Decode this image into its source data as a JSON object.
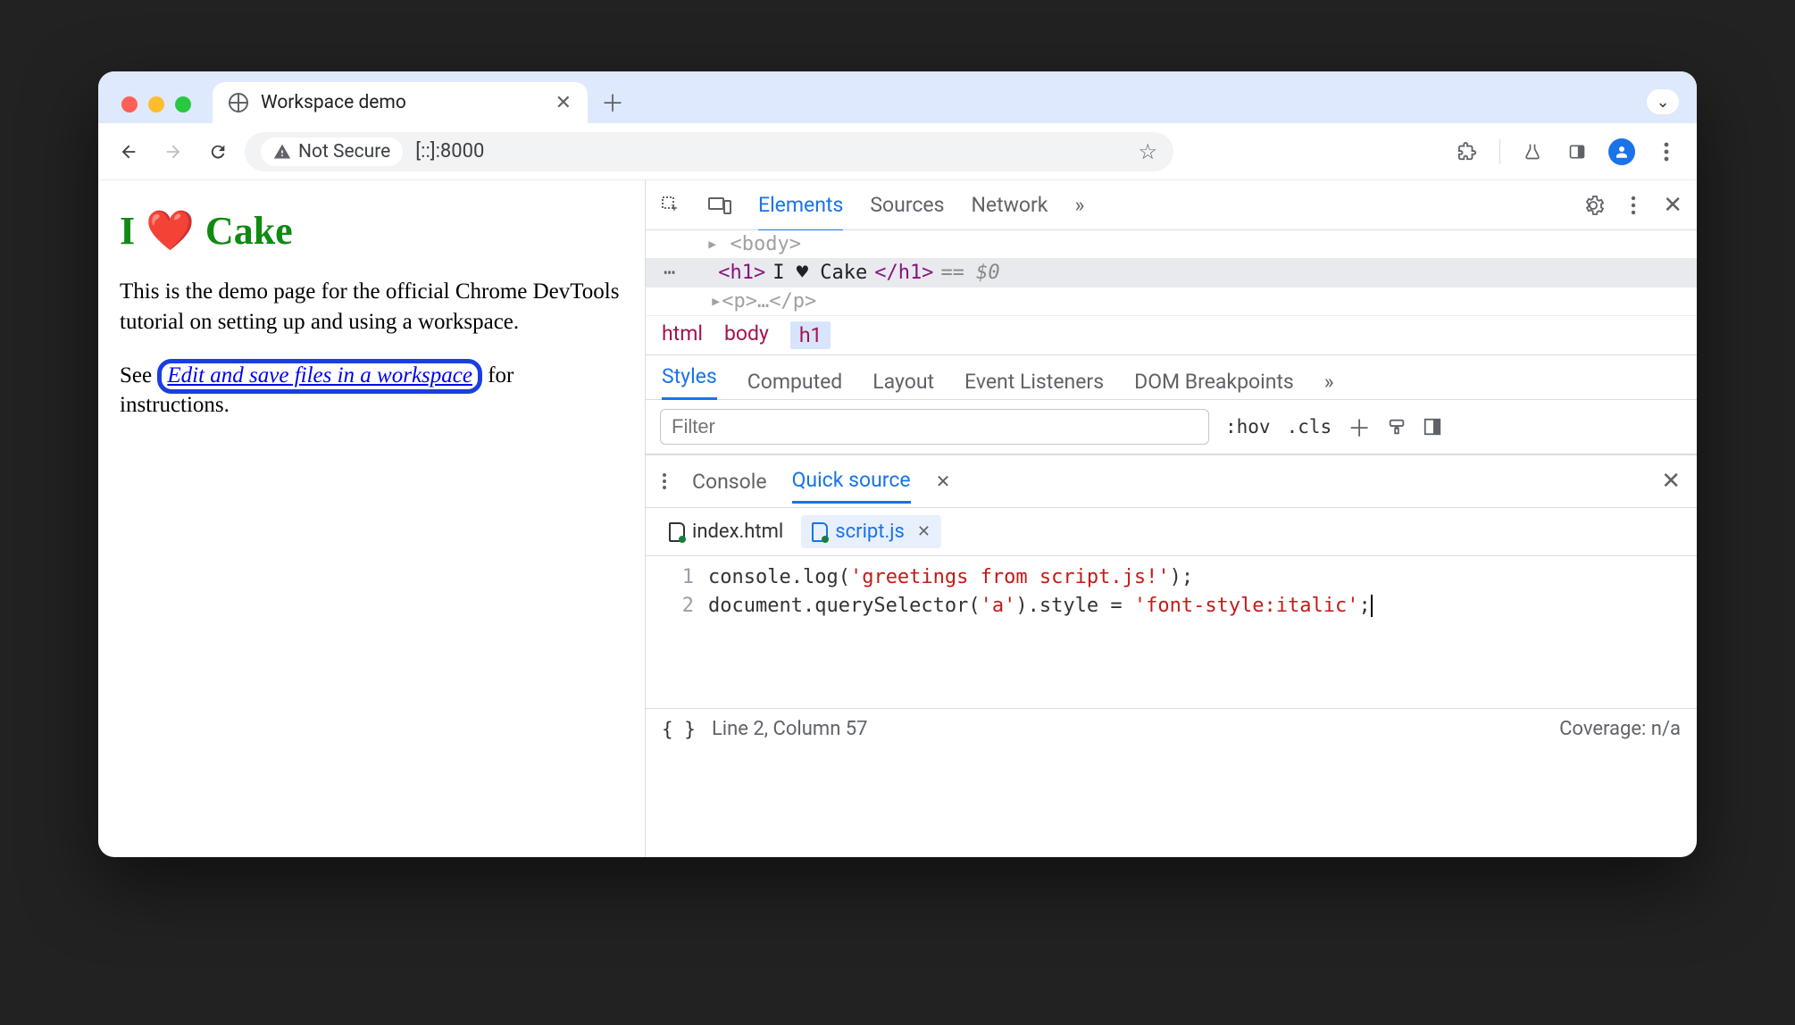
{
  "browser": {
    "tab_title": "Workspace demo",
    "security_chip": "Not Secure",
    "url": "[::]:8000"
  },
  "page": {
    "heading_prefix": "I",
    "heading_emoji": "❤️",
    "heading_suffix": "Cake",
    "paragraph": "This is the demo page for the official Chrome DevTools tutorial on setting up and using a workspace.",
    "cta_prefix": "See ",
    "cta_link": "Edit and save files in a workspace",
    "cta_suffix": " for instructions."
  },
  "devtools": {
    "tabs": {
      "elements": "Elements",
      "sources": "Sources",
      "network": "Network",
      "more": "»"
    },
    "dom": {
      "prev_line": "▸ <body>",
      "selected_open": "<h1>",
      "selected_text": "I ♥ Cake",
      "selected_close": "</h1>",
      "selected_after": "== $0",
      "next_line": "▸<p>…</p>"
    },
    "breadcrumbs": [
      "html",
      "body",
      "h1"
    ],
    "styles_tabs": {
      "styles": "Styles",
      "computed": "Computed",
      "layout": "Layout",
      "event_listeners": "Event Listeners",
      "dom_breakpoints": "DOM Breakpoints",
      "more": "»"
    },
    "filter_placeholder": "Filter",
    "styles_tools": {
      "hov": ":hov",
      "cls": ".cls"
    },
    "drawer": {
      "tabs": {
        "console": "Console",
        "quick_source": "Quick source"
      },
      "files": {
        "index": "index.html",
        "script": "script.js"
      },
      "code_lines": [
        "console.log('greetings from script.js!');",
        "document.querySelector('a').style = 'font-style:italic';"
      ],
      "status_line": "Line 2, Column 57",
      "coverage": "Coverage: n/a"
    }
  }
}
